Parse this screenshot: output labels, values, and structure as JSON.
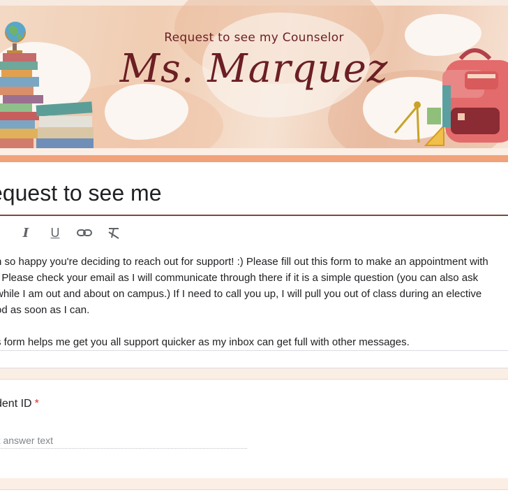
{
  "banner": {
    "subtitle": "Request to see my Counselor",
    "title": "Ms. Marquez"
  },
  "form": {
    "title": "equest to see me",
    "toolbar": {
      "italic": "I",
      "underline": "U"
    },
    "description": [
      "n so happy you're deciding to reach out for support! :) Please fill out this form to make an appointment with",
      ". Please check your email as I will communicate through there if it is a simple question (you can also ask",
      "while I am out and about on campus.) If I need to call you up, I will pull you out of class during an elective",
      "od as soon as I can.",
      "s form helps me get you all support quicker as my inbox can get full with other messages."
    ]
  },
  "question": {
    "label": "dent ID",
    "required_mark": "*",
    "placeholder": "rt answer text"
  },
  "colors": {
    "accent": "#f2a27a",
    "title_color": "#6b1f24",
    "required": "#d93025"
  },
  "icons": [
    "globe-icon",
    "books-icon",
    "backpack-icon",
    "compass-icon",
    "link-icon",
    "clear-format-icon"
  ]
}
